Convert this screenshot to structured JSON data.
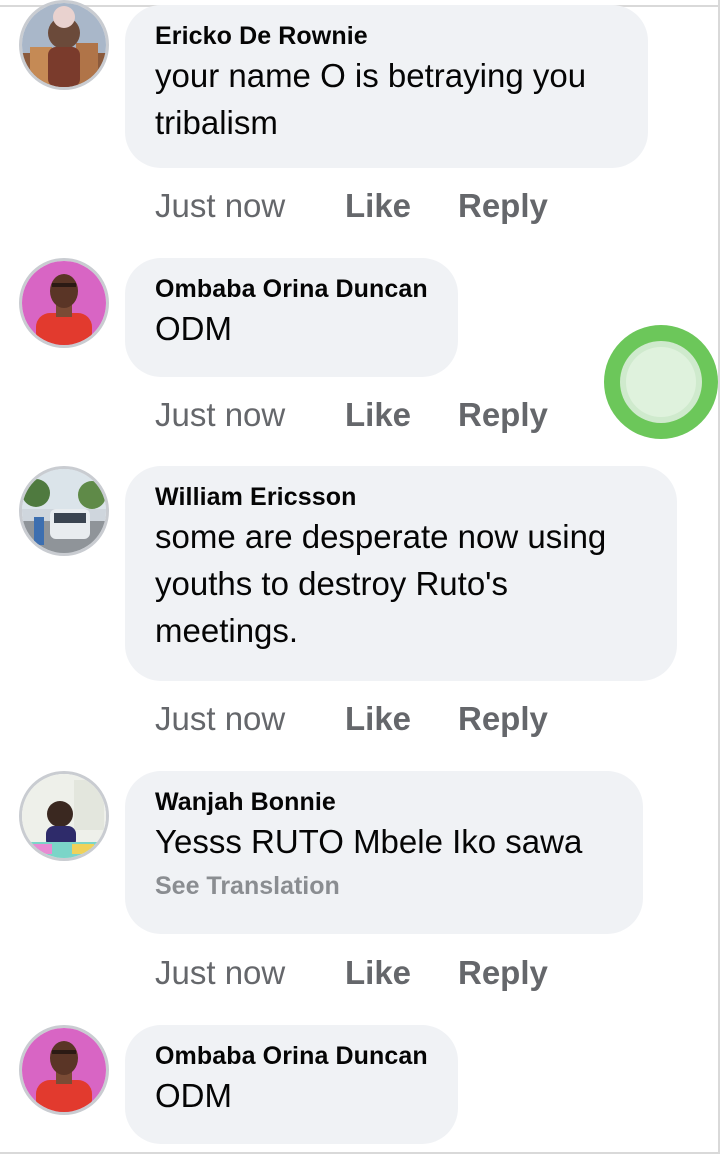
{
  "comments": [
    {
      "author": "Ericko De Rownie",
      "text_lines": [
        "your name O is betraying you",
        "tribalism"
      ],
      "time": "Just now",
      "like": "Like",
      "reply": "Reply",
      "avatar_icon": "person-with-building-avatar"
    },
    {
      "author": "Ombaba Orina Duncan",
      "text_lines": [
        "ODM"
      ],
      "time": "Just now",
      "like": "Like",
      "reply": "Reply",
      "avatar_icon": "person-red-shirt-avatar"
    },
    {
      "author": "William Ericsson",
      "text_lines": [
        "some are desperate now using",
        "youths to destroy Ruto's",
        "meetings."
      ],
      "time": "Just now",
      "like": "Like",
      "reply": "Reply",
      "avatar_icon": "street-scene-avatar"
    },
    {
      "author": "Wanjah Bonnie",
      "text_lines": [
        "Yesss RUTO Mbele Iko sawa"
      ],
      "see_translation": "See Translation",
      "time": "Just now",
      "like": "Like",
      "reply": "Reply",
      "avatar_icon": "woman-portrait-avatar"
    },
    {
      "author": "Ombaba Orina Duncan",
      "text_lines": [
        "ODM"
      ],
      "avatar_icon": "person-red-shirt-avatar"
    }
  ],
  "colors": {
    "bubble": "#f0f2f5",
    "meta_text": "#65676b",
    "touch_indicator": "#6cc75a"
  }
}
